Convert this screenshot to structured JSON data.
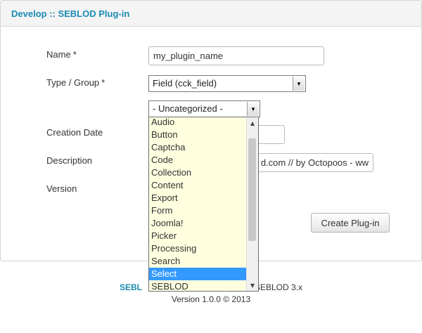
{
  "panel": {
    "title": "Develop :: SEBLOD Plug-in"
  },
  "form": {
    "name": {
      "label": "Name",
      "required_mark": "*",
      "value": "my_plugin_name"
    },
    "type_group": {
      "label": "Type / Group",
      "required_mark": "*",
      "type_value": "Field (cck_field)",
      "group_value": "- Uncategorized -"
    },
    "creation_date": {
      "label": "Creation Date",
      "value": ""
    },
    "description": {
      "label": "Description",
      "value": "d.com // by Octopoos - ww"
    },
    "version": {
      "label": "Version"
    },
    "create_button": "Create Plug-in"
  },
  "dropdown": {
    "options": [
      "Audio",
      "Button",
      "Captcha",
      "Code",
      "Collection",
      "Content",
      "Export",
      "Form",
      "Joomla!",
      "Picker",
      "Processing",
      "Search",
      "Select",
      "SEBLOD"
    ],
    "highlighted": "Select"
  },
  "footer": {
    "brand_left": "SEBL",
    "brand_right": "SEBLOD 3.x",
    "version_line": "Version 1.0.0 © 2013"
  }
}
